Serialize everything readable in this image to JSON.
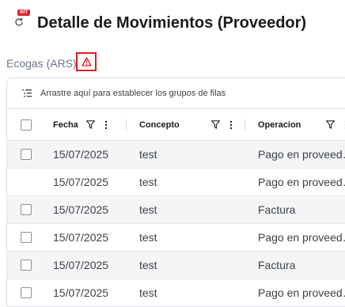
{
  "header": {
    "badge": "INT",
    "title": "Detalle de Movimientos (Proveedor)"
  },
  "subtitle": "Ecogas (ARS)",
  "grid": {
    "group_hint": "Arrastre aquí para establecer los grupos de filas",
    "columns": [
      "Fecha",
      "Concepto",
      "Operacion"
    ],
    "rows": [
      {
        "fecha": "15/07/2025",
        "concepto": "test",
        "operacion": "Pago en proveed…",
        "checkbox": true
      },
      {
        "fecha": "15/07/2025",
        "concepto": "test",
        "operacion": "Pago en proveed…",
        "checkbox": false
      },
      {
        "fecha": "15/07/2025",
        "concepto": "test",
        "operacion": "Factura",
        "checkbox": true
      },
      {
        "fecha": "15/07/2025",
        "concepto": "test",
        "operacion": "Pago en proveed…",
        "checkbox": true
      },
      {
        "fecha": "15/07/2025",
        "concepto": "test",
        "operacion": "Factura",
        "checkbox": true
      },
      {
        "fecha": "15/07/2025",
        "concepto": "test",
        "operacion": "Pago en proveed…",
        "checkbox": true
      }
    ]
  },
  "colors": {
    "badge": "#d9272e",
    "warning": "#e01b24",
    "subtitle": "#6b7685"
  }
}
